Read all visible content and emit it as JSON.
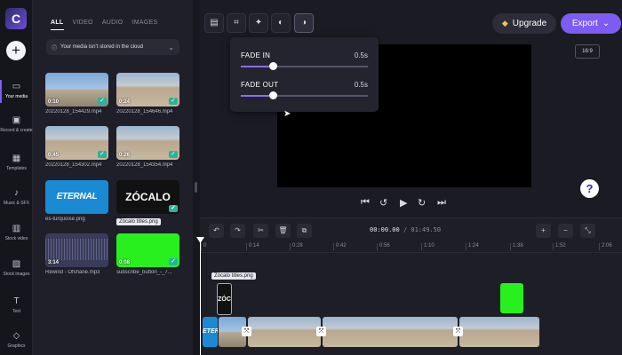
{
  "rail": {
    "logo": "C",
    "add": "+",
    "items": [
      {
        "label": "Your media"
      },
      {
        "label": "Record & create"
      },
      {
        "label": "Templates"
      },
      {
        "label": "Music & SFX"
      },
      {
        "label": "Stock video"
      },
      {
        "label": "Stock images"
      },
      {
        "label": "Text"
      },
      {
        "label": "Graphics"
      }
    ]
  },
  "media": {
    "tabs": [
      "ALL",
      "VIDEO",
      "AUDIO",
      "IMAGES"
    ],
    "notice": "Your media isn't stored in the cloud",
    "files": [
      {
        "name": "20220128_154429.mp4",
        "duration": "0:10"
      },
      {
        "name": "20220128_154646.mp4",
        "duration": "0:24"
      },
      {
        "name": "20220128_154302.mp4",
        "duration": "0:45"
      },
      {
        "name": "20220128_154354.mp4",
        "duration": "0:26"
      },
      {
        "name": "es-turquoise.png",
        "thumb_text": "ETERNAL SPRING"
      },
      {
        "name": "Zócalo titles.png",
        "thumb_text": "ZÓCALO"
      },
      {
        "name": "Rewind - Ofshane.mp3",
        "duration": "3:14"
      },
      {
        "name": "subscribe_button_-_7...",
        "duration": "0:08"
      }
    ]
  },
  "toolbar": {
    "upgrade": "Upgrade",
    "export": "Export",
    "ratio": "16:9"
  },
  "fade": {
    "in_label": "FADE IN",
    "in_value": "0.5s",
    "out_label": "FADE OUT",
    "out_value": "0.5s",
    "in_fraction": 0.25,
    "out_fraction": 0.25
  },
  "help": "?",
  "timeline": {
    "current": "00:00.00",
    "total": "01:49.50",
    "ticks": [
      "0",
      "0:14",
      "0:28",
      "0:42",
      "0:56",
      "1:10",
      "1:24",
      "1:38",
      "1:52",
      "2:06"
    ],
    "clip_label": "Zócalo titles.png",
    "text_clip": "ZÓC",
    "brand_clip": "ETER"
  },
  "colors": {
    "accent": "#7c5cf2",
    "check": "#2bb39a",
    "green_clip": "#28f01f"
  }
}
